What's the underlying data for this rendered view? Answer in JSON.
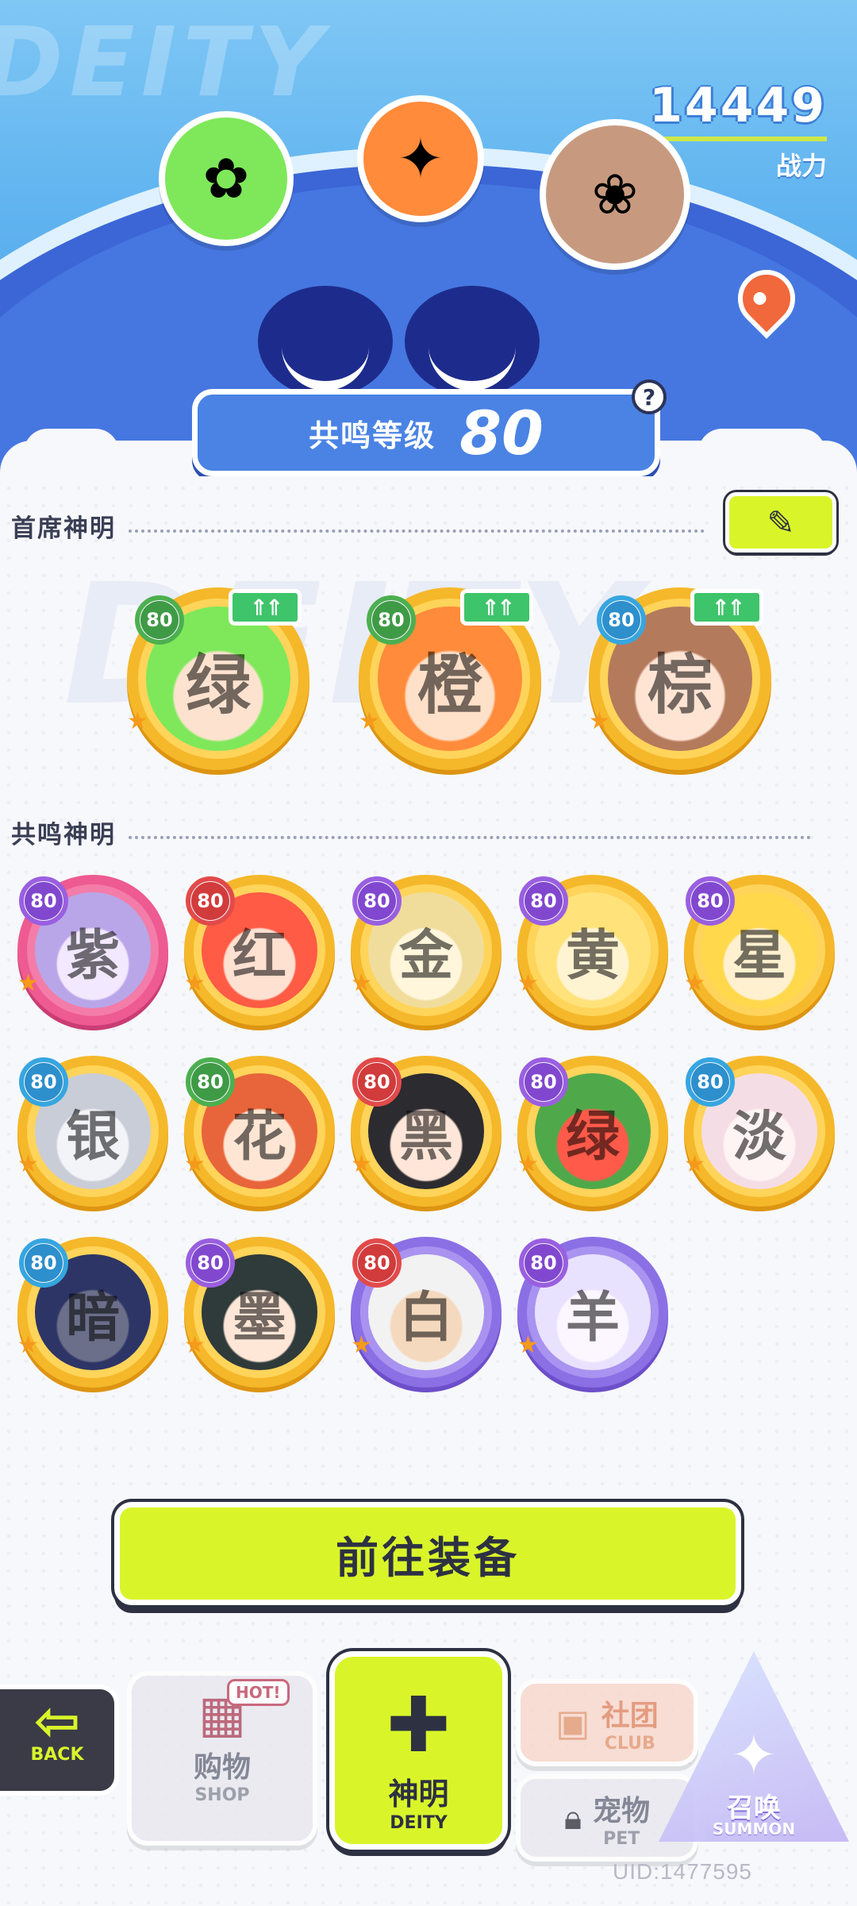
{
  "header": {
    "power_value": "14449",
    "power_label": "战力",
    "resonance_label": "共鸣等级",
    "resonance_level": "80",
    "help_icon": "question-icon",
    "watermark": "DEITY"
  },
  "chief_section": {
    "title": "首席神明",
    "edit_icon": "pencil-icon",
    "up_icon": "double-arrow-up-icon",
    "deities": [
      {
        "level": "80",
        "badge": "green",
        "initial": "绿",
        "colors": [
          "#7ee85a",
          "#fde3cf"
        ]
      },
      {
        "level": "80",
        "badge": "green",
        "initial": "橙",
        "colors": [
          "#ff8b3b",
          "#ffe0c8"
        ]
      },
      {
        "level": "80",
        "badge": "teal",
        "initial": "棕",
        "colors": [
          "#b47a5c",
          "#ffe4d4"
        ]
      }
    ]
  },
  "resonance_section": {
    "title": "共鸣神明",
    "deities": [
      {
        "level": "80",
        "badge": "violet",
        "frame": "pink",
        "initial": "紫",
        "colors": [
          "#b9a6e8",
          "#f2e8ff"
        ]
      },
      {
        "level": "80",
        "badge": "red",
        "frame": "gold",
        "initial": "红",
        "colors": [
          "#ff5b45",
          "#ffe1d2"
        ]
      },
      {
        "level": "80",
        "badge": "violet",
        "frame": "gold",
        "initial": "金",
        "colors": [
          "#f0dd9c",
          "#fff6dc"
        ]
      },
      {
        "level": "80",
        "badge": "violet",
        "frame": "gold",
        "initial": "黄",
        "colors": [
          "#ffe27a",
          "#fff4d2"
        ]
      },
      {
        "level": "80",
        "badge": "violet",
        "frame": "gold",
        "initial": "星",
        "colors": [
          "#ffd84c",
          "#fff1d0"
        ]
      },
      {
        "level": "80",
        "badge": "teal",
        "frame": "gold",
        "initial": "银",
        "colors": [
          "#c9cdd8",
          "#f3f4f8"
        ]
      },
      {
        "level": "80",
        "badge": "green",
        "frame": "gold",
        "initial": "花",
        "colors": [
          "#e8643a",
          "#ffe6d4"
        ]
      },
      {
        "level": "80",
        "badge": "red",
        "frame": "gold",
        "initial": "黑",
        "colors": [
          "#2c2b30",
          "#ffe6d8"
        ]
      },
      {
        "level": "80",
        "badge": "violet",
        "frame": "gold",
        "initial": "绿",
        "colors": [
          "#4fa94a",
          "#ff5a4a"
        ]
      },
      {
        "level": "80",
        "badge": "teal",
        "frame": "gold",
        "initial": "淡",
        "colors": [
          "#f5dde6",
          "#fff4f4"
        ]
      },
      {
        "level": "80",
        "badge": "teal",
        "frame": "gold",
        "initial": "暗",
        "colors": [
          "#2d3566",
          "#6b6f8a"
        ]
      },
      {
        "level": "80",
        "badge": "violet",
        "frame": "gold",
        "initial": "墨",
        "colors": [
          "#2f3a3a",
          "#ffe7d8"
        ]
      },
      {
        "level": "80",
        "badge": "red",
        "frame": "purple",
        "initial": "白",
        "colors": [
          "#f2f2f2",
          "#f5d9be"
        ]
      },
      {
        "level": "80",
        "badge": "violet",
        "frame": "purple",
        "initial": "羊",
        "colors": [
          "#e9e2ff",
          "#fbf6ff"
        ]
      }
    ]
  },
  "cta": {
    "label": "前往装备"
  },
  "nav": {
    "back": {
      "label": "BACK",
      "icon": "arrow-left-icon"
    },
    "shop": {
      "badge": "HOT!",
      "zh": "购物",
      "en": "SHOP",
      "icon": "vending-machine-icon"
    },
    "deity": {
      "zh": "神明",
      "en": "DEITY",
      "icon": "deity-chibi-icon"
    },
    "club": {
      "zh": "社团",
      "en": "CLUB",
      "icon": "bag-icon"
    },
    "pet": {
      "zh": "宠物",
      "en": "PET",
      "icon": "lock-icon"
    },
    "summon": {
      "zh": "召唤",
      "en": "SUMMON",
      "icon": "sparkle-icon"
    }
  },
  "uid": "UID:1477595"
}
